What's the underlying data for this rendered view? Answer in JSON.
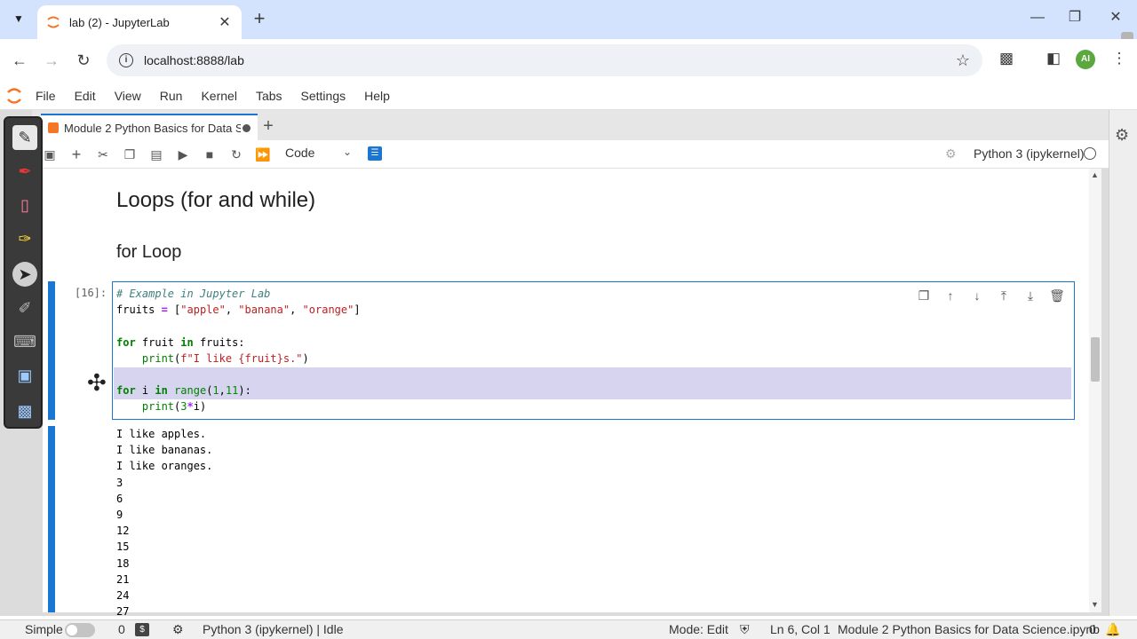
{
  "browser": {
    "tab_title": "lab (2) - JupyterLab",
    "url": "localhost:8888/lab",
    "avatar_initials": "AI"
  },
  "menu": [
    "File",
    "Edit",
    "View",
    "Run",
    "Kernel",
    "Tabs",
    "Settings",
    "Help"
  ],
  "document": {
    "tab_title": "Module 2 Python Basics for Data Science.ipynb",
    "cell_type": "Code",
    "kernel": "Python 3 (ipykernel)"
  },
  "notebook": {
    "heading2": "Loops (for and while)",
    "heading3": "for Loop",
    "prompt": "[16]:",
    "output_lines": [
      "I like apples.",
      "I like bananas.",
      "I like oranges.",
      "3",
      "6",
      "9",
      "12",
      "15",
      "18",
      "21",
      "24",
      "27"
    ]
  },
  "statusbar": {
    "mode_label": "Simple",
    "count_left": "0",
    "count_right": "0",
    "kernel_status": "Python 3 (ipykernel) | Idle",
    "mode": "Mode: Edit",
    "position": "Ln 6, Col 1",
    "filename": "Module 2 Python Basics for Data Science.ipynb"
  },
  "colors": {
    "accent": "#1976d2",
    "selection": "#d7d4f0",
    "tabstrip": "#d3e3fd"
  }
}
